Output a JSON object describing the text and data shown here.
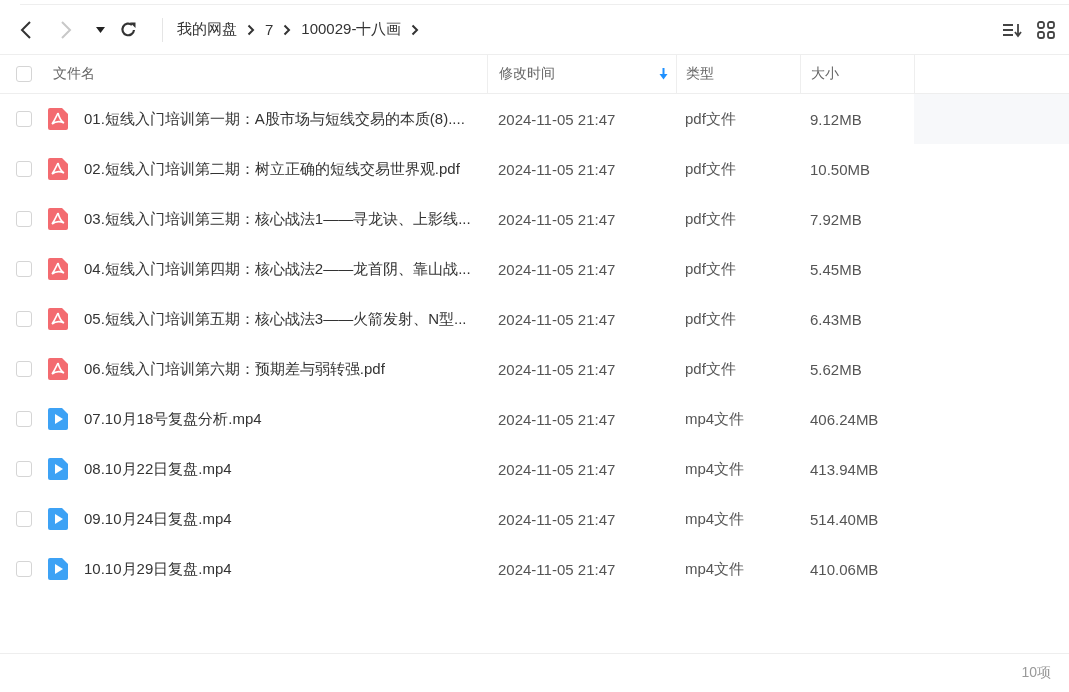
{
  "toolbar": {
    "back_disabled": false,
    "forward_disabled": true,
    "breadcrumbs": [
      "我的网盘",
      "7",
      "100029-十八画"
    ]
  },
  "table": {
    "select_all": {
      "checked": false
    },
    "columns": [
      {
        "label": "文件名",
        "sorted": false
      },
      {
        "label": "修改时间",
        "sorted": true
      },
      {
        "label": "类型",
        "sorted": false
      },
      {
        "label": "大小",
        "sorted": false
      }
    ],
    "rows": [
      {
        "kind": "pdf",
        "name": "01.短线入门培训第一期：A股市场与短线交易的本质(8)....",
        "modified": "2024-11-05 21:47",
        "type": "pdf文件",
        "size": "9.12MB",
        "checked": false,
        "hovered": true
      },
      {
        "kind": "pdf",
        "name": "02.短线入门培训第二期：树立正确的短线交易世界观.pdf",
        "modified": "2024-11-05 21:47",
        "type": "pdf文件",
        "size": "10.50MB",
        "checked": false,
        "hovered": false
      },
      {
        "kind": "pdf",
        "name": "03.短线入门培训第三期：核心战法1——寻龙诀、上影线...",
        "modified": "2024-11-05 21:47",
        "type": "pdf文件",
        "size": "7.92MB",
        "checked": false,
        "hovered": false
      },
      {
        "kind": "pdf",
        "name": "04.短线入门培训第四期：核心战法2——龙首阴、靠山战...",
        "modified": "2024-11-05 21:47",
        "type": "pdf文件",
        "size": "5.45MB",
        "checked": false,
        "hovered": false
      },
      {
        "kind": "pdf",
        "name": "05.短线入门培训第五期：核心战法3——火箭发射、N型...",
        "modified": "2024-11-05 21:47",
        "type": "pdf文件",
        "size": "6.43MB",
        "checked": false,
        "hovered": false
      },
      {
        "kind": "pdf",
        "name": "06.短线入门培训第六期：预期差与弱转强.pdf",
        "modified": "2024-11-05 21:47",
        "type": "pdf文件",
        "size": "5.62MB",
        "checked": false,
        "hovered": false
      },
      {
        "kind": "video",
        "name": "07.10月18号复盘分析.mp4",
        "modified": "2024-11-05 21:47",
        "type": "mp4文件",
        "size": "406.24MB",
        "checked": false,
        "hovered": false
      },
      {
        "kind": "video",
        "name": "08.10月22日复盘.mp4",
        "modified": "2024-11-05 21:47",
        "type": "mp4文件",
        "size": "413.94MB",
        "checked": false,
        "hovered": false
      },
      {
        "kind": "video",
        "name": "09.10月24日复盘.mp4",
        "modified": "2024-11-05 21:47",
        "type": "mp4文件",
        "size": "514.40MB",
        "checked": false,
        "hovered": false
      },
      {
        "kind": "video",
        "name": "10.10月29日复盘.mp4",
        "modified": "2024-11-05 21:47",
        "type": "mp4文件",
        "size": "410.06MB",
        "checked": false,
        "hovered": false
      }
    ]
  },
  "status_bar": {
    "count": "10项"
  }
}
